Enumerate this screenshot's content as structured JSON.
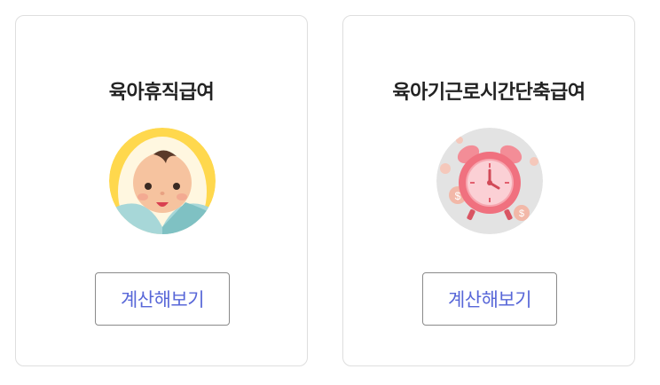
{
  "cards": [
    {
      "title": "육아휴직급여",
      "illustration": "baby-icon",
      "button_label": "계산해보기"
    },
    {
      "title": "육아기근로시간단축급여",
      "illustration": "alarm-clock-icon",
      "button_label": "계산해보기"
    }
  ],
  "colors": {
    "button_text": "#5867d8",
    "card_border": "#dedede",
    "baby_ring": "#ffd84d",
    "clock_bg": "#e3e3e3",
    "clock_body": "#f0717f"
  }
}
